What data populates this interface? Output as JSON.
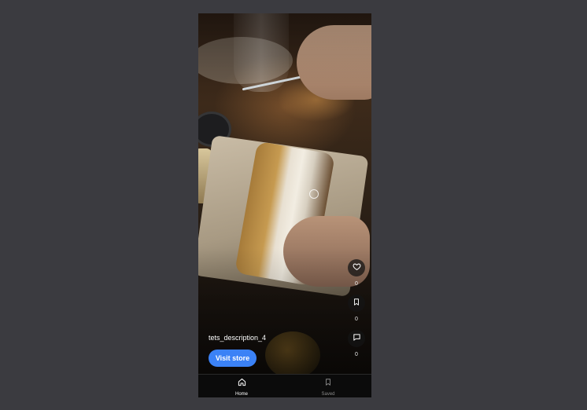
{
  "post": {
    "description": "tets_description_4",
    "visit_store_label": "Visit store"
  },
  "actions": {
    "likes_count": "0",
    "saves_count": "0",
    "comments_count": "0",
    "like_icon": "heart-icon",
    "save_icon": "bookmark-icon",
    "comment_icon": "comment-icon"
  },
  "bottom_nav": {
    "items": [
      {
        "label": "Home",
        "icon": "home-icon",
        "active": true
      },
      {
        "label": "Saved",
        "icon": "bookmark-icon",
        "active": false
      }
    ]
  },
  "colors": {
    "accent": "#3b82f6",
    "background": "#3b3b40",
    "nav_background": "#0b0b0b"
  }
}
